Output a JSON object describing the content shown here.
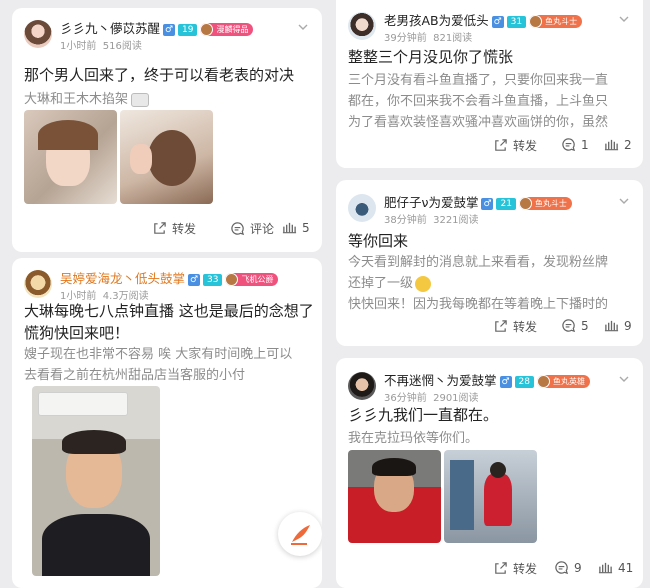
{
  "posts": [
    {
      "username": "彡彡九丶儚苡苏醒",
      "level": "19",
      "fan_badge": "漫麟得品",
      "time": "1小时前",
      "reads": "516阅读",
      "title": "那个男人回来了，终于可以看老表的对决",
      "body": "大琳和王木木掐架",
      "actions": {
        "share": "转发",
        "comment": "评论",
        "like": "5"
      }
    },
    {
      "username": "吴婷爱海龙丶低头鼓掌",
      "level": "33",
      "fan_badge": "飞机公爵",
      "time": "1小时前",
      "reads": "4.3万阅读",
      "title_lines": [
        "大琳每晚七八点钟直播 这也是最后的念想了",
        "慌狗快回来吧！"
      ],
      "body_lines": [
        "嫂子现在也非常不容易 唉 大家有时间晚上可以",
        "去看看之前在杭州甜品店当客服的小付"
      ]
    },
    {
      "username": "老男孩AB为爱低头",
      "level": "31",
      "fan_badge": "鱼丸斗士",
      "time": "39分钟前",
      "reads": "821阅读",
      "title": "整整三个月没见你了慌张",
      "body_lines": [
        "三个月没有看斗鱼直播了，只要你回来我一直",
        "都在，你不回来我不会看斗鱼直播，上斗鱼只",
        "为了看喜欢装怪喜欢骚冲喜欢画饼的你，虽然"
      ],
      "actions": {
        "share": "转发",
        "comment": "1",
        "like": "2"
      }
    },
    {
      "username": "肥仔子ν为爱鼓掌",
      "level": "21",
      "fan_badge": "鱼丸斗士",
      "time": "38分钟前",
      "reads": "3221阅读",
      "title": "等你回来",
      "body_lines": [
        "今天看到解封的消息就上来看看，发现粉丝牌",
        "还掉了一级",
        "快快回来！因为我每晚都在等着晚上下播时的"
      ],
      "actions": {
        "share": "转发",
        "comment": "5",
        "like": "9"
      }
    },
    {
      "username": "不再迷惘丶为爱鼓掌",
      "level": "28",
      "fan_badge": "鱼丸英雄",
      "time": "36分钟前",
      "reads": "2901阅读",
      "title": "彡彡九我们一直都在。",
      "body": "我在克拉玛依等你们。",
      "actions": {
        "share": "转发",
        "comment": "9",
        "like": "41"
      }
    }
  ],
  "colors": {
    "level": "#27c4d9",
    "male": "#4a90e2",
    "fan": "#f0724a",
    "compose": "#ee6a3a"
  },
  "icons": [
    "more-icon",
    "share-icon",
    "comment-icon",
    "like-icon",
    "compose-icon"
  ]
}
